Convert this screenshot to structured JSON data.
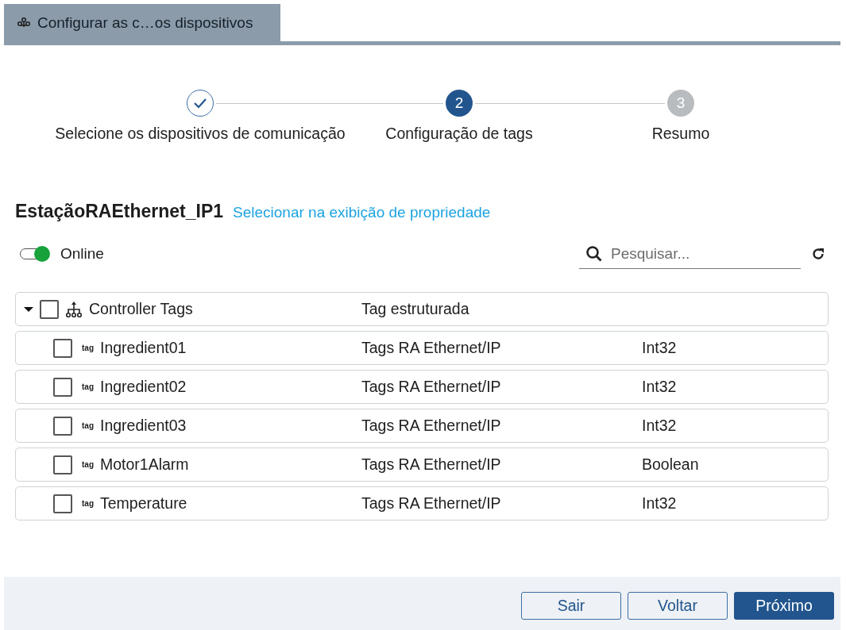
{
  "window": {
    "title": "Configurar as c…os dispositivos"
  },
  "steps": [
    {
      "label": "Selecione os dispositivos de comunicação",
      "completed": true,
      "selected": false
    },
    {
      "number": "2",
      "label": "Configuração de tags",
      "completed": false,
      "selected": true
    },
    {
      "number": "3",
      "label": "Resumo",
      "completed": false,
      "selected": false
    }
  ],
  "device": {
    "name": "EstaçãoRAEthernet_IP1",
    "link": "Selecionar na exibição de propriedade"
  },
  "online_toggle": {
    "label": "Online",
    "on": true
  },
  "search": {
    "placeholder": "Pesquisar..."
  },
  "tree": {
    "label": "Controller Tags",
    "expanded": true,
    "checked": false,
    "column_2": "Tag estruturada",
    "children": [
      {
        "badge": "tag",
        "name": "Ingredient01",
        "column_2": "Tags RA Ethernet/IP",
        "column_3": "Int32",
        "checked": false
      },
      {
        "badge": "tag",
        "name": "Ingredient02",
        "column_2": "Tags RA Ethernet/IP",
        "column_3": "Int32",
        "checked": false
      },
      {
        "badge": "tag",
        "name": "Ingredient03",
        "column_2": "Tags RA Ethernet/IP",
        "column_3": "Int32",
        "checked": false
      },
      {
        "badge": "tag",
        "name": "Motor1Alarm",
        "column_2": "Tags RA Ethernet/IP",
        "column_3": "Boolean",
        "checked": false
      },
      {
        "badge": "tag",
        "name": "Temperature",
        "column_2": "Tags RA Ethernet/IP",
        "column_3": "Int32",
        "checked": false
      }
    ]
  },
  "buttons": [
    {
      "label": "Sair",
      "kind": "secondary"
    },
    {
      "label": "Voltar",
      "kind": "secondary"
    },
    {
      "label": "Próximo",
      "kind": "primary"
    }
  ]
}
